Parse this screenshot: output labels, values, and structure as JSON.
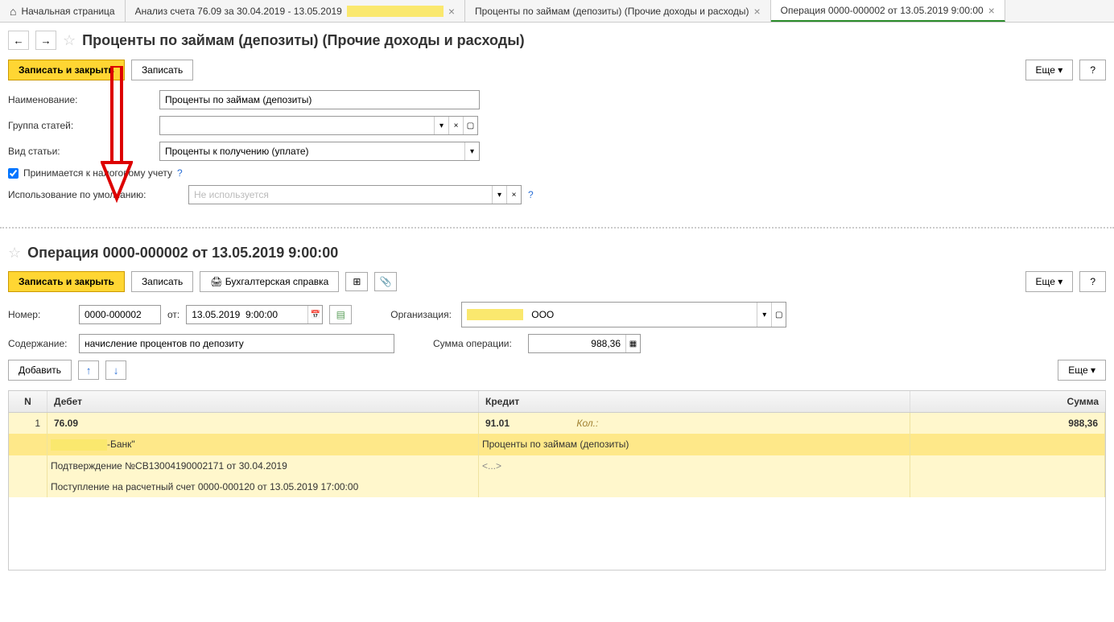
{
  "tabs": {
    "home": "Начальная страница",
    "t1": "Анализ счета 76.09 за 30.04.2019 - 13.05.2019",
    "t2": "Проценты по займам (депозиты) (Прочие доходы и расходы)",
    "t3": "Операция 0000-000002 от 13.05.2019 9:00:00"
  },
  "pane1": {
    "title": "Проценты по займам (депозиты) (Прочие доходы и расходы)",
    "write_close": "Записать и закрыть",
    "write": "Записать",
    "more": "Еще",
    "help": "?",
    "naimenovanie_label": "Наименование:",
    "naimenovanie_val": "Проценты по займам (депозиты)",
    "gruppa_label": "Группа статей:",
    "gruppa_val": "",
    "vid_label": "Вид статьи:",
    "vid_val": "Проценты к получению (уплате)",
    "tax_checkbox_label": "Принимается к налоговому учету",
    "tax_checked": true,
    "usage_label": "Использование по умолчанию:",
    "usage_placeholder": "Не используется"
  },
  "pane2": {
    "title": "Операция 0000-000002 от 13.05.2019 9:00:00",
    "write_close": "Записать и закрыть",
    "write": "Записать",
    "print": "Бухгалтерская справка",
    "more": "Еще",
    "help": "?",
    "nomer_label": "Номер:",
    "nomer_val": "0000-000002",
    "ot_label": "от:",
    "date_val": "13.05.2019  9:00:00",
    "org_label": "Организация:",
    "org_val": "ООО",
    "content_label": "Содержание:",
    "content_val": "начисление процентов по депозиту",
    "sum_label": "Сумма операции:",
    "sum_val": "988,36",
    "add": "Добавить",
    "table": {
      "h_n": "N",
      "h_debit": "Дебет",
      "h_credit": "Кредит",
      "h_sum": "Сумма",
      "row": {
        "n": "1",
        "debit_acc": "76.09",
        "credit_acc": "91.01",
        "kol_label": "Кол.:",
        "sum": "988,36",
        "debit_sub1": "-Банк\"",
        "credit_sub1": "Проценты по займам (депозиты)",
        "debit_sub2": "Подтверждение №СВ13004190002171 от 30.04.2019",
        "credit_sub2": "<...>",
        "debit_sub3": "Поступление на расчетный счет 0000-000120 от 13.05.2019 17:00:00"
      }
    }
  }
}
